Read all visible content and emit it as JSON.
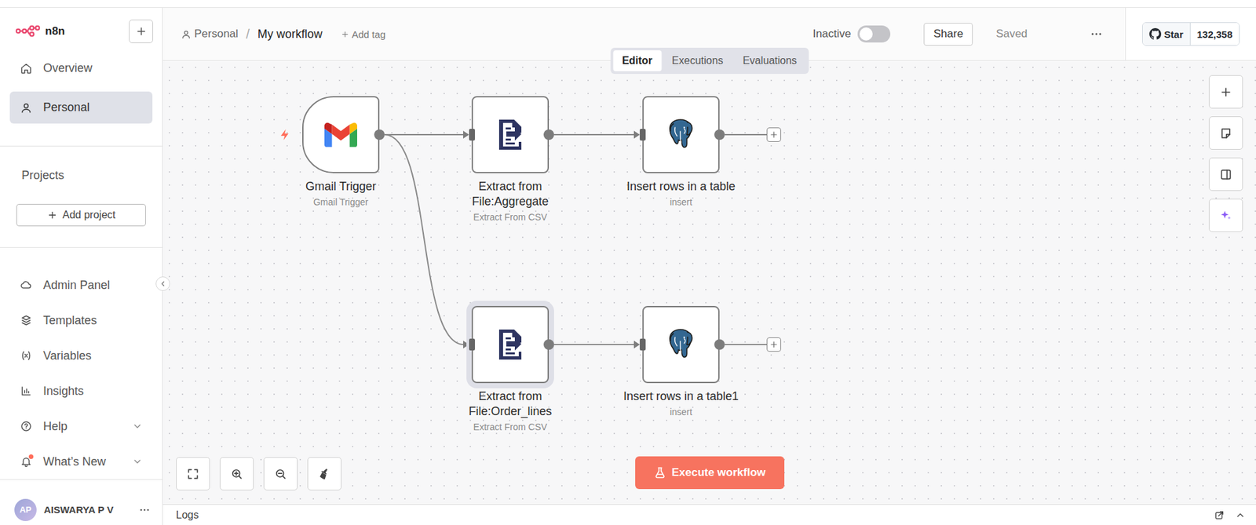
{
  "sidebar": {
    "logo": "n8n",
    "nav": [
      {
        "label": "Overview",
        "selected": false
      },
      {
        "label": "Personal",
        "selected": true
      }
    ],
    "projects_heading": "Projects",
    "add_project": "Add project",
    "links": [
      {
        "label": "Admin Panel",
        "has_submenu": false,
        "notification": false
      },
      {
        "label": "Templates",
        "has_submenu": false,
        "notification": false
      },
      {
        "label": "Variables",
        "has_submenu": false,
        "notification": false
      },
      {
        "label": "Insights",
        "has_submenu": false,
        "notification": false
      },
      {
        "label": "Help",
        "has_submenu": true,
        "notification": false
      },
      {
        "label": "What’s New",
        "has_submenu": true,
        "notification": true
      }
    ],
    "user": {
      "initials": "AP",
      "name": "AISWARYA P V"
    }
  },
  "header": {
    "project": "Personal",
    "separator": "/",
    "workflow": "My workflow",
    "add_tag": "Add tag",
    "active_label": "Inactive",
    "active": false,
    "share": "Share",
    "save_status": "Saved",
    "github": {
      "label": "Star",
      "count": "132,358"
    }
  },
  "view_tabs": [
    {
      "label": "Editor",
      "selected": true
    },
    {
      "label": "Executions",
      "selected": false
    },
    {
      "label": "Evaluations",
      "selected": false
    }
  ],
  "nodes": [
    {
      "title": "Gmail Trigger",
      "subtitle": "Gmail Trigger",
      "kind": "trigger",
      "selected": false
    },
    {
      "title": "Extract from File:Aggregate",
      "subtitle": "Extract From CSV",
      "kind": "extract",
      "selected": false
    },
    {
      "title": "Insert rows in a table",
      "subtitle": "insert",
      "kind": "postgres",
      "selected": false
    },
    {
      "title": "Extract from File:Order_lines",
      "subtitle": "Extract From CSV",
      "kind": "extract",
      "selected": true
    },
    {
      "title": "Insert rows in a table1",
      "subtitle": "insert",
      "kind": "postgres",
      "selected": false
    }
  ],
  "connections": [
    {
      "from": 0,
      "to": 1
    },
    {
      "from": 1,
      "to": 2
    },
    {
      "from": 0,
      "to": 3
    },
    {
      "from": 3,
      "to": 4
    }
  ],
  "execute_button": "Execute workflow",
  "logs": {
    "label": "Logs"
  }
}
